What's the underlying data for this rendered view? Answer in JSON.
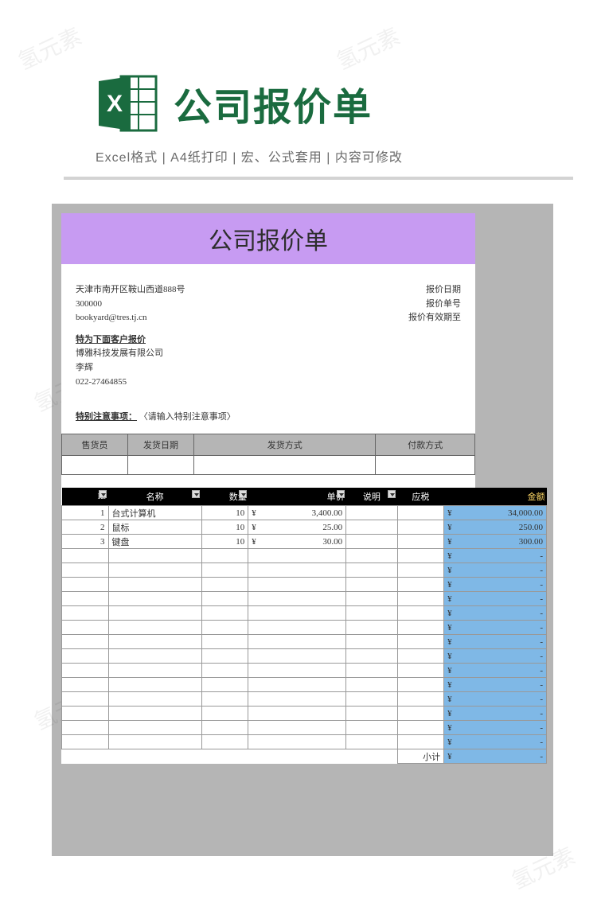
{
  "watermark": "氢元素",
  "header": {
    "title": "公司报价单",
    "subtitle": "Excel格式 |  A4纸打印 | 宏、公式套用 | 内容可修改"
  },
  "sheet": {
    "title": "公司报价单",
    "company": {
      "address": "天津市南开区鞍山西道888号",
      "postcode": "300000",
      "email": "bookyard@tres.tj.cn"
    },
    "meta_labels": {
      "quote_date": "报价日期",
      "quote_no": "报价单号",
      "quote_valid": "报价有效期至"
    },
    "client": {
      "heading": "特为下面客户报价",
      "name": "博雅科技发展有限公司",
      "contact": "李辉",
      "phone": "022-27464855"
    },
    "notes": {
      "label": "特别注意事项：",
      "placeholder": "〈请输入特别注意事项〉"
    },
    "ship_headers": {
      "sales": "售货员",
      "ship_date": "发货日期",
      "ship_method": "发货方式",
      "pay_method": "付款方式"
    },
    "item_headers": {
      "id": "ID",
      "name": "名称",
      "qty": "数量",
      "price": "单价",
      "desc": "说明",
      "tax": "应税",
      "amount": "金额"
    },
    "currency": "¥",
    "items": [
      {
        "id": "1",
        "name": "台式计算机",
        "qty": "10",
        "price": "3,400.00",
        "amount": "34,000.00"
      },
      {
        "id": "2",
        "name": "鼠标",
        "qty": "10",
        "price": "25.00",
        "amount": "250.00"
      },
      {
        "id": "3",
        "name": "键盘",
        "qty": "10",
        "price": "30.00",
        "amount": "300.00"
      }
    ],
    "empty_rows": 14,
    "subtotal_label": "小计",
    "dash": "-"
  }
}
